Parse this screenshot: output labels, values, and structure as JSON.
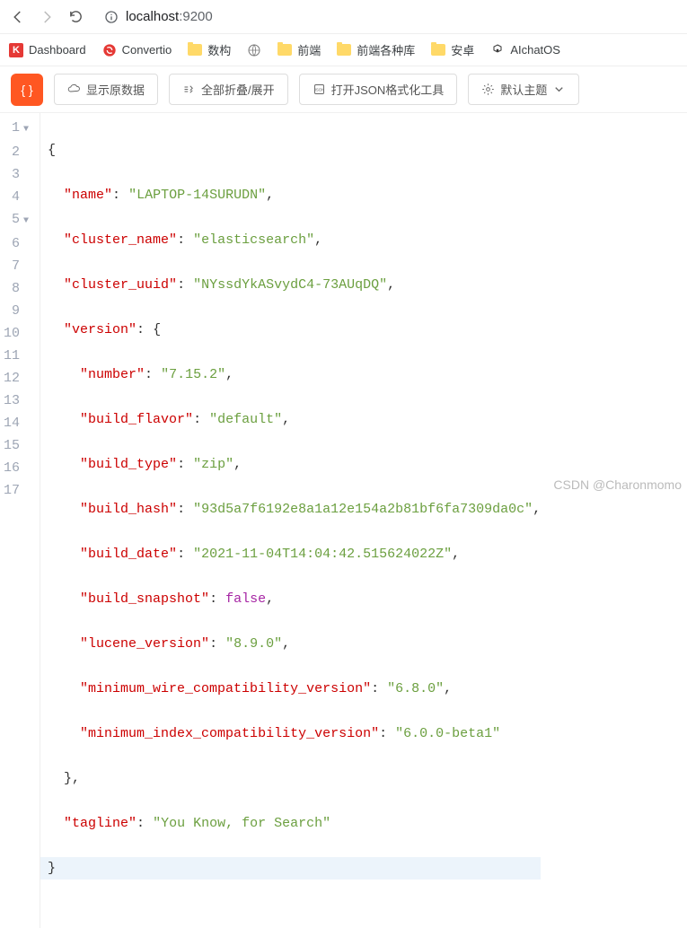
{
  "nav": {
    "url_host": "localhost",
    "url_port": ":9200"
  },
  "bookmarks": [
    {
      "id": "dashboard",
      "label": "Dashboard",
      "icon": "k"
    },
    {
      "id": "convertio",
      "label": "Convertio",
      "icon": "convertio"
    },
    {
      "id": "f1",
      "label": "数构",
      "icon": "folder"
    },
    {
      "id": "globe",
      "label": "",
      "icon": "globe"
    },
    {
      "id": "f2",
      "label": "前端",
      "icon": "folder"
    },
    {
      "id": "f3",
      "label": "前端各种库",
      "icon": "folder"
    },
    {
      "id": "f4",
      "label": "安卓",
      "icon": "folder"
    },
    {
      "id": "aichat",
      "label": "AIchatOS",
      "icon": "openai"
    }
  ],
  "toolbar": {
    "raw": "显示原数据",
    "fold": "全部折叠/展开",
    "open_tool": "打开JSON格式化工具",
    "theme": "默认主题"
  },
  "json": {
    "name": "LAPTOP-14SURUDN",
    "cluster_name": "elasticsearch",
    "cluster_uuid": "NYssdYkASvydC4-73AUqDQ",
    "version": {
      "number": "7.15.2",
      "build_flavor": "default",
      "build_type": "zip",
      "build_hash": "93d5a7f6192e8a1a12e154a2b81bf6fa7309da0c",
      "build_date": "2021-11-04T14:04:42.515624022Z",
      "build_snapshot": "false",
      "lucene_version": "8.9.0",
      "minimum_wire_compatibility_version": "6.8.0",
      "minimum_index_compatibility_version": "6.0.0-beta1"
    },
    "tagline": "You Know, for Search"
  },
  "watermark": "CSDN @Charonmomo"
}
